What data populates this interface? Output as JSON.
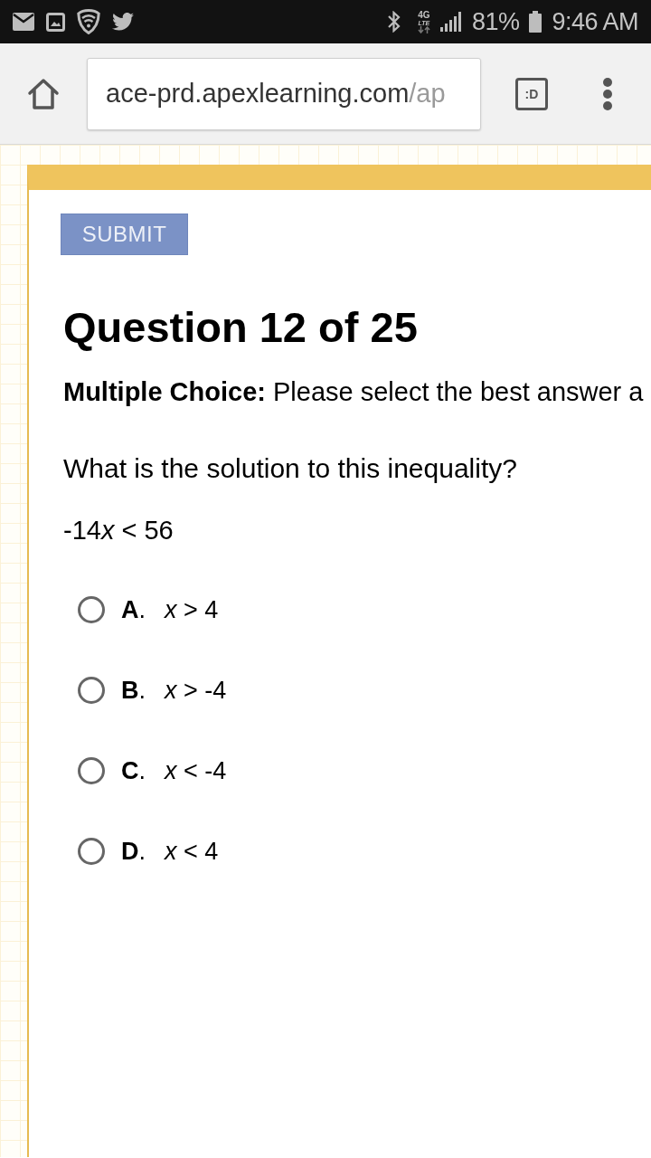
{
  "status_bar": {
    "network_top": "4G",
    "network_bottom": "LTE",
    "battery": "81%",
    "time": "9:46 AM"
  },
  "browser": {
    "url_host": "ace-prd.apexlearning.com",
    "url_path": "/ap",
    "tabs_label": ":D"
  },
  "quiz": {
    "submit": "SUBMIT",
    "title": "Question 12 of 25",
    "instructions": "**Multiple Choice:** Please select the best answer a",
    "question": "What is the solution to this inequality?",
    "expression": [
      {
        "text": "-14",
        "italic": false
      },
      {
        "text": "x",
        "italic": true
      },
      {
        "text": " < 56",
        "italic": false
      }
    ],
    "choices": [
      {
        "letter": "**A**.",
        "text": "*x* > 4",
        "selected": false
      },
      {
        "letter": "**B**.",
        "text": "*x* > -4",
        "selected": false
      },
      {
        "letter": "**C**.",
        "text": "*x* < -4",
        "selected": false
      },
      {
        "letter": "**D**.",
        "text": "*x* < 4",
        "selected": false
      }
    ]
  }
}
